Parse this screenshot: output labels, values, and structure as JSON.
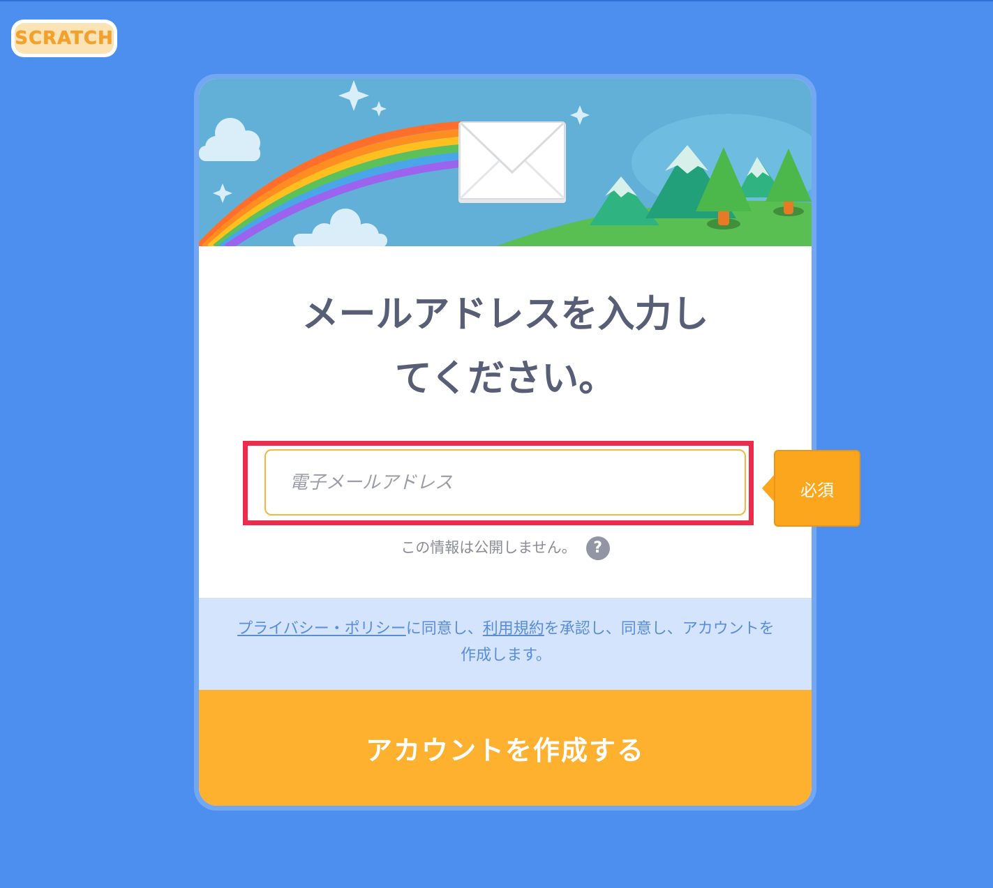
{
  "logo": {
    "text": "SCRATCH"
  },
  "dialog": {
    "title_line1": "メールアドレスを入力し",
    "title_line2": "てください。",
    "email": {
      "placeholder": "電子メールアドレス",
      "value": "",
      "required_label": "必須"
    },
    "privacy_note": "この情報は公開しません。",
    "help_icon": "?",
    "terms": {
      "privacy_link": "プライバシー・ポリシー",
      "text_1": "に同意し、",
      "terms_link": "利用規約",
      "text_2": "を承認し、同意し、アカウントを作成します。"
    },
    "create_button": "アカウントを作成する"
  },
  "colors": {
    "background": "#4C8FEF",
    "button": "#FDB12F",
    "highlight": "#ED2B4A",
    "terms_band": "#D4E4FD",
    "title_text": "#575E75"
  }
}
